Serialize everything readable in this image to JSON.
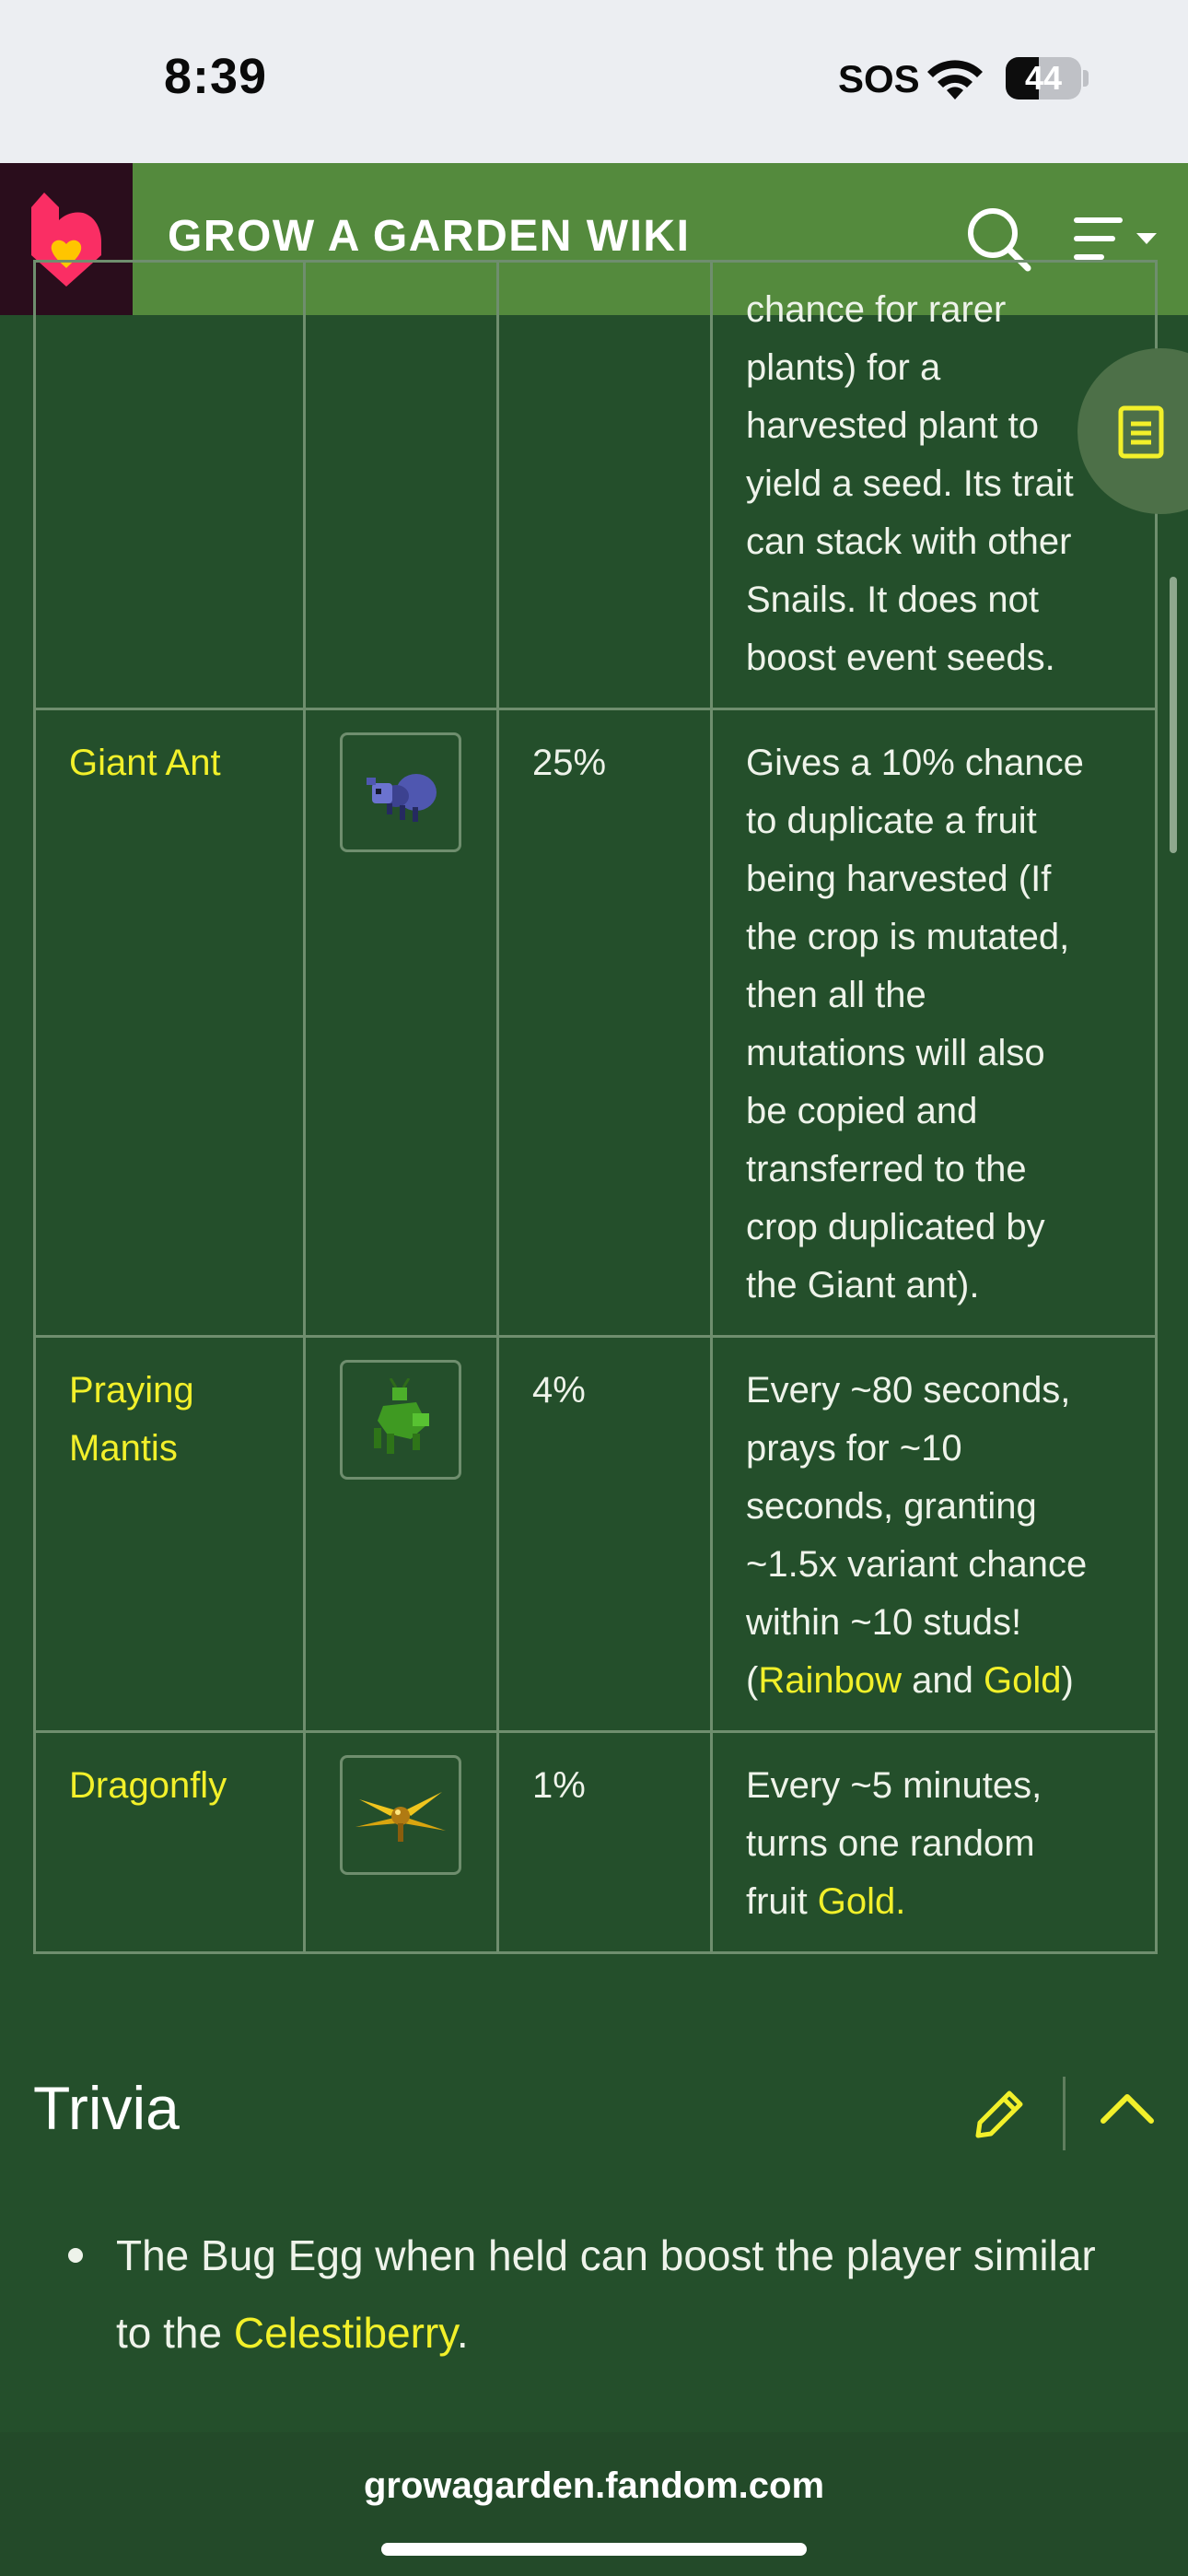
{
  "status_bar": {
    "time": "8:39",
    "signal_text": "SOS",
    "battery_level": "44",
    "battery_fraction": 0.44
  },
  "header": {
    "title": "GROW A GARDEN WIKI",
    "brand_color": "#548a3d",
    "logo_color": "#fa2e64"
  },
  "table": {
    "top_partial_desc_lines": [
      "chance for rarer",
      "plants) for a",
      "harvested plant to",
      "yield a seed. Its trait",
      "can stack with other",
      "Snails. It does not",
      "boost event seeds."
    ],
    "rows": [
      {
        "name": "Giant Ant",
        "icon": "giant-ant-icon",
        "chance": "25%",
        "desc_lines": [
          "Gives a 10% chance",
          "to duplicate a fruit",
          "being harvested (If",
          "the crop is mutated,",
          "then all the",
          "mutations will also",
          "be copied and",
          "transferred to the",
          "crop duplicated by",
          "the Giant ant)."
        ]
      },
      {
        "name_line1": "Praying",
        "name_line2": "Mantis",
        "icon": "praying-mantis-icon",
        "chance": "4%",
        "desc_lines": [
          "Every ~80 seconds,",
          "prays for ~10",
          "seconds, granting",
          "~1.5x variant chance",
          "within ~10 studs!"
        ],
        "desc_open": "(",
        "rainbow_link": "Rainbow",
        "and_text": " and ",
        "gold_link": "Gold",
        "desc_close": ")"
      },
      {
        "name": "Dragonfly",
        "icon": "dragonfly-icon",
        "chance": "1%",
        "desc_lines": [
          "Every ~5 minutes,",
          "turns one random"
        ],
        "desc_last_prefix": "fruit ",
        "gold_link": "Gold."
      }
    ]
  },
  "trivia": {
    "title": "Trivia",
    "item_line1": "The Bug Egg when held can boost the player similar",
    "item_line2_prefix": "to the ",
    "item_link": "Celestiberry",
    "item_line2_suffix": "."
  },
  "bottom": {
    "url": "growagarden.fandom.com"
  },
  "colors": {
    "page_bg": "#244f2b",
    "link": "#f2f02a",
    "border": "#6f8e6e"
  }
}
